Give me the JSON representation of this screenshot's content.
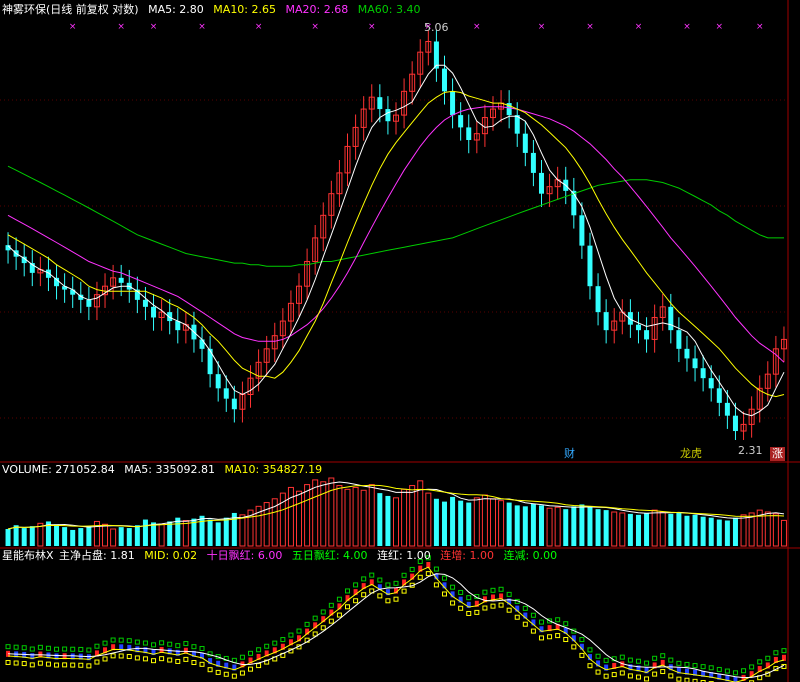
{
  "price_panel": {
    "stock_name": "神雾环保",
    "mode": "(日线 前复权 对数)",
    "ma5_label": "MA5: 2.80",
    "ma10_label": "MA10: 2.65",
    "ma20_label": "MA20: 2.68",
    "ma60_label": "MA60: 3.40",
    "high_label": "5.06",
    "low_label": "2.31",
    "badge_cai": "财",
    "badge_longhu": "龙虎",
    "badge_zhang": "涨",
    "colors": {
      "ma5": "#ffffff",
      "ma10": "#ffff00",
      "ma20": "#ff33ff",
      "ma60": "#00cc00",
      "up": "#ff3333",
      "down": "#33ffff"
    }
  },
  "volume_panel": {
    "volume_label": "VOLUME: 271052.84",
    "ma5_label": "MA5: 335092.81",
    "ma10_label": "MA10: 354827.19"
  },
  "indicator_panel": {
    "name": "星能布林X",
    "main_label": "主净占盘: 1.81",
    "mid_label": "MID: 0.02",
    "ten_day_label": "十日飘红: 6.00",
    "five_day_label": "五日飘红: 4.00",
    "lianhong_label": "连红: 1.00",
    "lianzeng_label": "连增: 1.00",
    "lianjian_label": "连减: 0.00"
  },
  "chart_data": {
    "type": "candlestick",
    "price_high": 5.06,
    "price_low": 2.31,
    "close": [
      3.32,
      3.28,
      3.24,
      3.18,
      3.2,
      3.15,
      3.1,
      3.08,
      3.05,
      3.02,
      2.98,
      3.05,
      3.1,
      3.15,
      3.12,
      3.08,
      3.02,
      2.98,
      2.92,
      2.95,
      2.9,
      2.85,
      2.88,
      2.8,
      2.75,
      2.62,
      2.55,
      2.5,
      2.45,
      2.52,
      2.6,
      2.68,
      2.75,
      2.82,
      2.9,
      3.0,
      3.1,
      3.25,
      3.4,
      3.55,
      3.7,
      3.85,
      4.05,
      4.2,
      4.35,
      4.45,
      4.35,
      4.25,
      4.3,
      4.5,
      4.65,
      4.85,
      4.95,
      4.7,
      4.5,
      4.3,
      4.2,
      4.1,
      4.15,
      4.28,
      4.35,
      4.4,
      4.3,
      4.15,
      4.0,
      3.85,
      3.7,
      3.75,
      3.8,
      3.72,
      3.55,
      3.35,
      3.1,
      2.95,
      2.85,
      2.9,
      2.95,
      2.88,
      2.85,
      2.8,
      2.92,
      2.98,
      2.85,
      2.75,
      2.7,
      2.65,
      2.6,
      2.55,
      2.48,
      2.42,
      2.35,
      2.38,
      2.45,
      2.55,
      2.62,
      2.75,
      2.8
    ],
    "ma5": [
      3.35,
      3.3,
      3.27,
      3.23,
      3.2,
      3.18,
      3.14,
      3.1,
      3.08,
      3.04,
      3.02,
      3.03,
      3.06,
      3.09,
      3.1,
      3.1,
      3.07,
      3.03,
      2.99,
      2.96,
      2.92,
      2.9,
      2.88,
      2.84,
      2.8,
      2.74,
      2.67,
      2.6,
      2.54,
      2.52,
      2.54,
      2.57,
      2.62,
      2.67,
      2.75,
      2.83,
      2.92,
      3.02,
      3.14,
      3.28,
      3.42,
      3.57,
      3.73,
      3.9,
      4.06,
      4.2,
      4.28,
      4.32,
      4.34,
      4.37,
      4.41,
      4.53,
      4.65,
      4.73,
      4.73,
      4.66,
      4.53,
      4.39,
      4.25,
      4.2,
      4.21,
      4.26,
      4.29,
      4.29,
      4.25,
      4.14,
      4.0,
      3.87,
      3.8,
      3.76,
      3.7,
      3.61,
      3.47,
      3.31,
      3.16,
      3.03,
      2.95,
      2.91,
      2.89,
      2.87,
      2.88,
      2.89,
      2.88,
      2.86,
      2.84,
      2.79,
      2.71,
      2.64,
      2.58,
      2.52,
      2.46,
      2.43,
      2.42,
      2.44,
      2.47,
      2.55,
      2.63
    ],
    "ma10": [
      3.42,
      3.39,
      3.36,
      3.33,
      3.3,
      3.27,
      3.23,
      3.2,
      3.17,
      3.14,
      3.1,
      3.08,
      3.07,
      3.07,
      3.07,
      3.07,
      3.07,
      3.07,
      3.05,
      3.03,
      3.0,
      2.98,
      2.95,
      2.92,
      2.88,
      2.83,
      2.79,
      2.74,
      2.69,
      2.65,
      2.63,
      2.61,
      2.61,
      2.6,
      2.63,
      2.68,
      2.74,
      2.82,
      2.9,
      3.0,
      3.12,
      3.24,
      3.37,
      3.5,
      3.63,
      3.76,
      3.88,
      3.99,
      4.08,
      4.16,
      4.24,
      4.32,
      4.4,
      4.45,
      4.49,
      4.5,
      4.49,
      4.46,
      4.44,
      4.42,
      4.4,
      4.4,
      4.38,
      4.35,
      4.32,
      4.27,
      4.22,
      4.16,
      4.1,
      4.04,
      3.96,
      3.87,
      3.77,
      3.66,
      3.56,
      3.47,
      3.39,
      3.32,
      3.25,
      3.18,
      3.12,
      3.06,
      3.0,
      2.95,
      2.91,
      2.87,
      2.83,
      2.79,
      2.75,
      2.7,
      2.65,
      2.61,
      2.57,
      2.54,
      2.52,
      2.51,
      2.52
    ],
    "ma20": [
      3.55,
      3.52,
      3.49,
      3.46,
      3.43,
      3.4,
      3.37,
      3.34,
      3.31,
      3.28,
      3.25,
      3.23,
      3.21,
      3.19,
      3.18,
      3.16,
      3.14,
      3.12,
      3.1,
      3.08,
      3.06,
      3.04,
      3.01,
      2.98,
      2.95,
      2.92,
      2.89,
      2.86,
      2.83,
      2.81,
      2.8,
      2.79,
      2.79,
      2.79,
      2.8,
      2.82,
      2.85,
      2.88,
      2.92,
      2.97,
      3.03,
      3.1,
      3.18,
      3.27,
      3.37,
      3.47,
      3.57,
      3.67,
      3.77,
      3.87,
      3.96,
      4.05,
      4.13,
      4.2,
      4.26,
      4.3,
      4.33,
      4.35,
      4.36,
      4.37,
      4.37,
      4.37,
      4.36,
      4.35,
      4.33,
      4.31,
      4.29,
      4.27,
      4.24,
      4.21,
      4.17,
      4.12,
      4.07,
      4.01,
      3.95,
      3.88,
      3.82,
      3.75,
      3.68,
      3.61,
      3.54,
      3.47,
      3.4,
      3.34,
      3.28,
      3.22,
      3.16,
      3.1,
      3.04,
      2.98,
      2.92,
      2.87,
      2.82,
      2.78,
      2.75,
      2.72,
      2.68
    ],
    "ma60": [
      3.9,
      3.87,
      3.84,
      3.81,
      3.78,
      3.75,
      3.72,
      3.69,
      3.66,
      3.63,
      3.6,
      3.57,
      3.54,
      3.51,
      3.48,
      3.45,
      3.42,
      3.4,
      3.38,
      3.36,
      3.34,
      3.32,
      3.3,
      3.29,
      3.28,
      3.27,
      3.26,
      3.25,
      3.24,
      3.24,
      3.23,
      3.23,
      3.22,
      3.22,
      3.22,
      3.22,
      3.23,
      3.23,
      3.24,
      3.25,
      3.25,
      3.26,
      3.27,
      3.28,
      3.29,
      3.3,
      3.31,
      3.32,
      3.33,
      3.34,
      3.35,
      3.36,
      3.37,
      3.38,
      3.39,
      3.4,
      3.42,
      3.44,
      3.46,
      3.48,
      3.5,
      3.52,
      3.54,
      3.56,
      3.58,
      3.6,
      3.62,
      3.64,
      3.66,
      3.68,
      3.7,
      3.72,
      3.74,
      3.76,
      3.77,
      3.78,
      3.79,
      3.8,
      3.8,
      3.8,
      3.79,
      3.78,
      3.76,
      3.74,
      3.71,
      3.68,
      3.65,
      3.62,
      3.58,
      3.55,
      3.51,
      3.48,
      3.45,
      3.42,
      3.4,
      3.4,
      3.4
    ],
    "volume": [
      180000,
      220000,
      190000,
      210000,
      240000,
      260000,
      230000,
      200000,
      170000,
      190000,
      210000,
      260000,
      230000,
      180000,
      200000,
      190000,
      220000,
      280000,
      250000,
      230000,
      260000,
      300000,
      270000,
      290000,
      320000,
      280000,
      250000,
      300000,
      350000,
      330000,
      380000,
      420000,
      460000,
      500000,
      560000,
      620000,
      580000,
      650000,
      700000,
      680000,
      720000,
      640000,
      600000,
      620000,
      590000,
      650000,
      560000,
      530000,
      510000,
      600000,
      640000,
      690000,
      560000,
      500000,
      470000,
      520000,
      480000,
      460000,
      510000,
      540000,
      500000,
      480000,
      460000,
      430000,
      420000,
      450000,
      430000,
      400000,
      410000,
      390000,
      420000,
      440000,
      410000,
      390000,
      380000,
      360000,
      350000,
      340000,
      330000,
      350000,
      380000,
      360000,
      340000,
      350000,
      320000,
      330000,
      310000,
      300000,
      280000,
      270000,
      300000,
      330000,
      350000,
      380000,
      360000,
      340000,
      271052.84
    ],
    "main_value": 1.81,
    "mid_value": 0.02
  }
}
